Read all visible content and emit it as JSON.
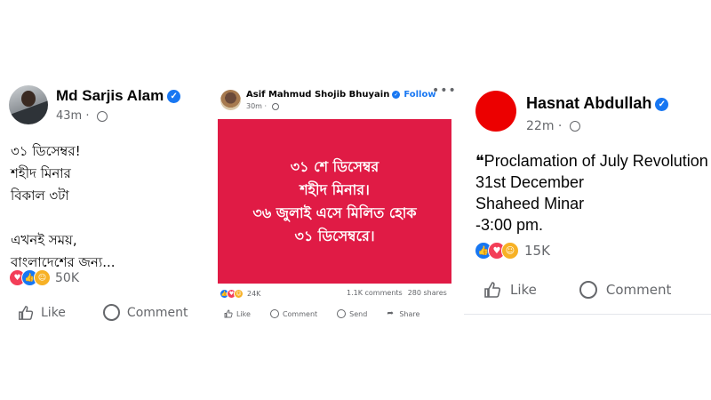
{
  "posts": [
    {
      "author": "Md Sarjis Alam",
      "time": "43m",
      "lines": [
        "৩১ ডিসেম্বর!",
        "শহীদ মিনার",
        "বিকাল ৩টা",
        "",
        "এখনই সময়,",
        "বাংলাদেশের জন্য..."
      ],
      "reactions": [
        "love",
        "like",
        "care"
      ],
      "reaction_count": "50K",
      "actions": {
        "like": "Like",
        "comment": "Comment"
      }
    },
    {
      "author": "Asif Mahmud Shojib Bhuyain",
      "follow": "Follow",
      "time": "30m",
      "card_lines": [
        "৩১ শে ডিসেম্বর",
        "শহীদ মিনার।",
        "৩৬ জুলাই এসে মিলিত হোক",
        "৩১ ডিসেম্বরে।"
      ],
      "card_color": "#e01b45",
      "reactions": [
        "like",
        "love",
        "care"
      ],
      "reaction_count": "24K",
      "comments": "1.1K comments",
      "shares": "280 shares",
      "actions": {
        "like": "Like",
        "comment": "Comment",
        "send": "Send",
        "share": "Share"
      }
    },
    {
      "author": "Hasnat Abdullah",
      "time": "22m",
      "lines": [
        "❝Proclamation of July Revolution",
        "31st December",
        "Shaheed Minar",
        "-3:00 pm."
      ],
      "avatar_color": "#ec0000",
      "reactions": [
        "like",
        "love",
        "care"
      ],
      "reaction_count": "15K",
      "actions": {
        "like": "Like",
        "comment": "Comment"
      }
    }
  ],
  "colors": {
    "verified": "#1877f2",
    "like": "#1877f2",
    "love": "#f33e58",
    "care": "#f7b125"
  }
}
